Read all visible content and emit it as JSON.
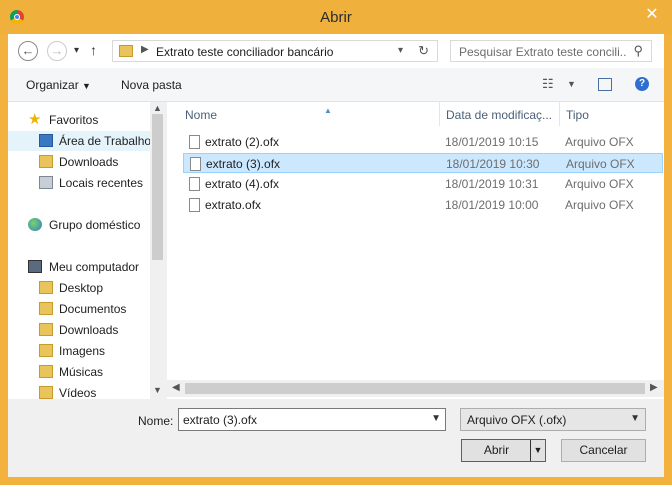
{
  "window": {
    "title": "Abrir"
  },
  "nav": {
    "address_path": "Extrato teste conciliador bancário",
    "search_placeholder": "Pesquisar Extrato teste concili..."
  },
  "toolbar": {
    "organize": "Organizar",
    "new_folder": "Nova pasta"
  },
  "sidebar": {
    "favorites": "Favoritos",
    "favorites_items": [
      "Área de Trabalho",
      "Downloads",
      "Locais recentes"
    ],
    "homegroup": "Grupo doméstico",
    "computer": "Meu computador",
    "computer_items": [
      "Desktop",
      "Documentos",
      "Downloads",
      "Imagens",
      "Músicas",
      "Vídeos"
    ]
  },
  "columns": {
    "name": "Nome",
    "date": "Data de modificaç...",
    "type": "Tipo"
  },
  "files": [
    {
      "name": "extrato (2).ofx",
      "date": "18/01/2019 10:15",
      "type": "Arquivo OFX"
    },
    {
      "name": "extrato (3).ofx",
      "date": "18/01/2019 10:30",
      "type": "Arquivo OFX"
    },
    {
      "name": "extrato (4).ofx",
      "date": "18/01/2019 10:31",
      "type": "Arquivo OFX"
    },
    {
      "name": "extrato.ofx",
      "date": "18/01/2019 10:00",
      "type": "Arquivo OFX"
    }
  ],
  "footer": {
    "name_label": "Nome:",
    "name_value": "extrato (3).ofx",
    "filter": "Arquivo OFX (.ofx)",
    "open": "Abrir",
    "cancel": "Cancelar"
  },
  "colors": {
    "titlebar": "#f0b03c",
    "selection": "#cce8ff",
    "accent": "#0078d7"
  }
}
